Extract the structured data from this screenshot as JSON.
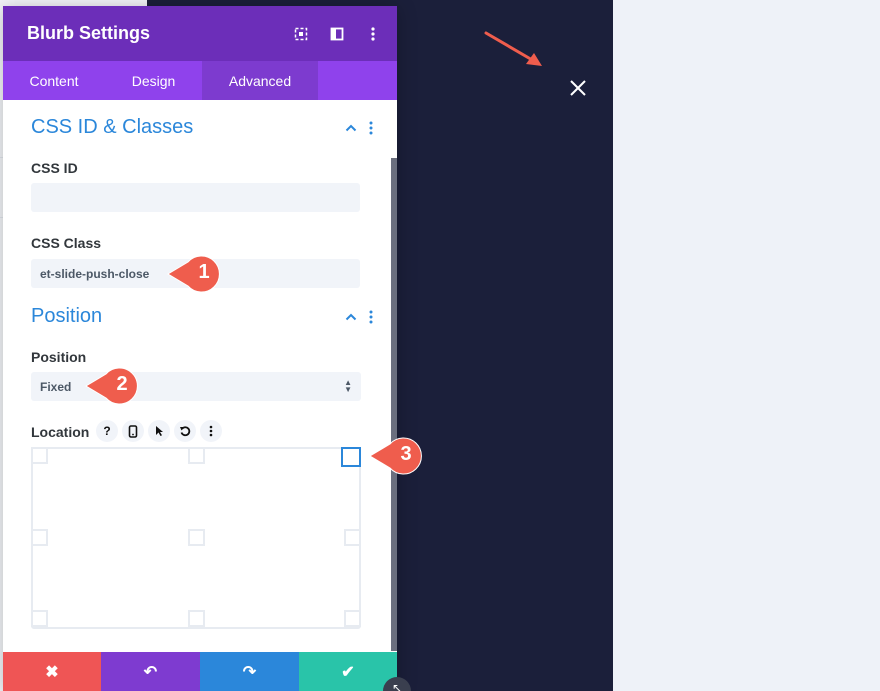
{
  "panel": {
    "title": "Blurb Settings",
    "header_icons": [
      "fullscreen-icon",
      "split-view-icon",
      "more-vertical-icon"
    ]
  },
  "tabs": [
    {
      "label": "Content",
      "active": false
    },
    {
      "label": "Design",
      "active": false
    },
    {
      "label": "Advanced",
      "active": true
    }
  ],
  "sections": {
    "css": {
      "title": "CSS ID & Classes",
      "css_id_label": "CSS ID",
      "css_id_value": "",
      "css_class_label": "CSS Class",
      "css_class_value": "et-slide-push-close"
    },
    "position": {
      "title": "Position",
      "position_label": "Position",
      "position_value": "Fixed",
      "location_label": "Location",
      "location_selected": "top-right",
      "location_icons": [
        "?",
        "mobile-icon",
        "cursor-icon",
        "reset-icon",
        "more-vertical-icon"
      ]
    }
  },
  "annotations": [
    {
      "number": "1"
    },
    {
      "number": "2"
    },
    {
      "number": "3"
    }
  ],
  "footer": {
    "buttons": [
      {
        "name": "discard",
        "symbol": "✖",
        "color": "#ef5555"
      },
      {
        "name": "undo",
        "symbol": "↶",
        "color": "#7e3bd0"
      },
      {
        "name": "redo",
        "symbol": "↷",
        "color": "#2b87da"
      },
      {
        "name": "save",
        "symbol": "✔",
        "color": "#29c4a9"
      }
    ]
  },
  "colors": {
    "header": "#6c2eb9",
    "tabs": "#8f42ec",
    "accent": "#2b87da",
    "badge": "#ef5d4d",
    "dark_bg": "#1b1f3a"
  }
}
